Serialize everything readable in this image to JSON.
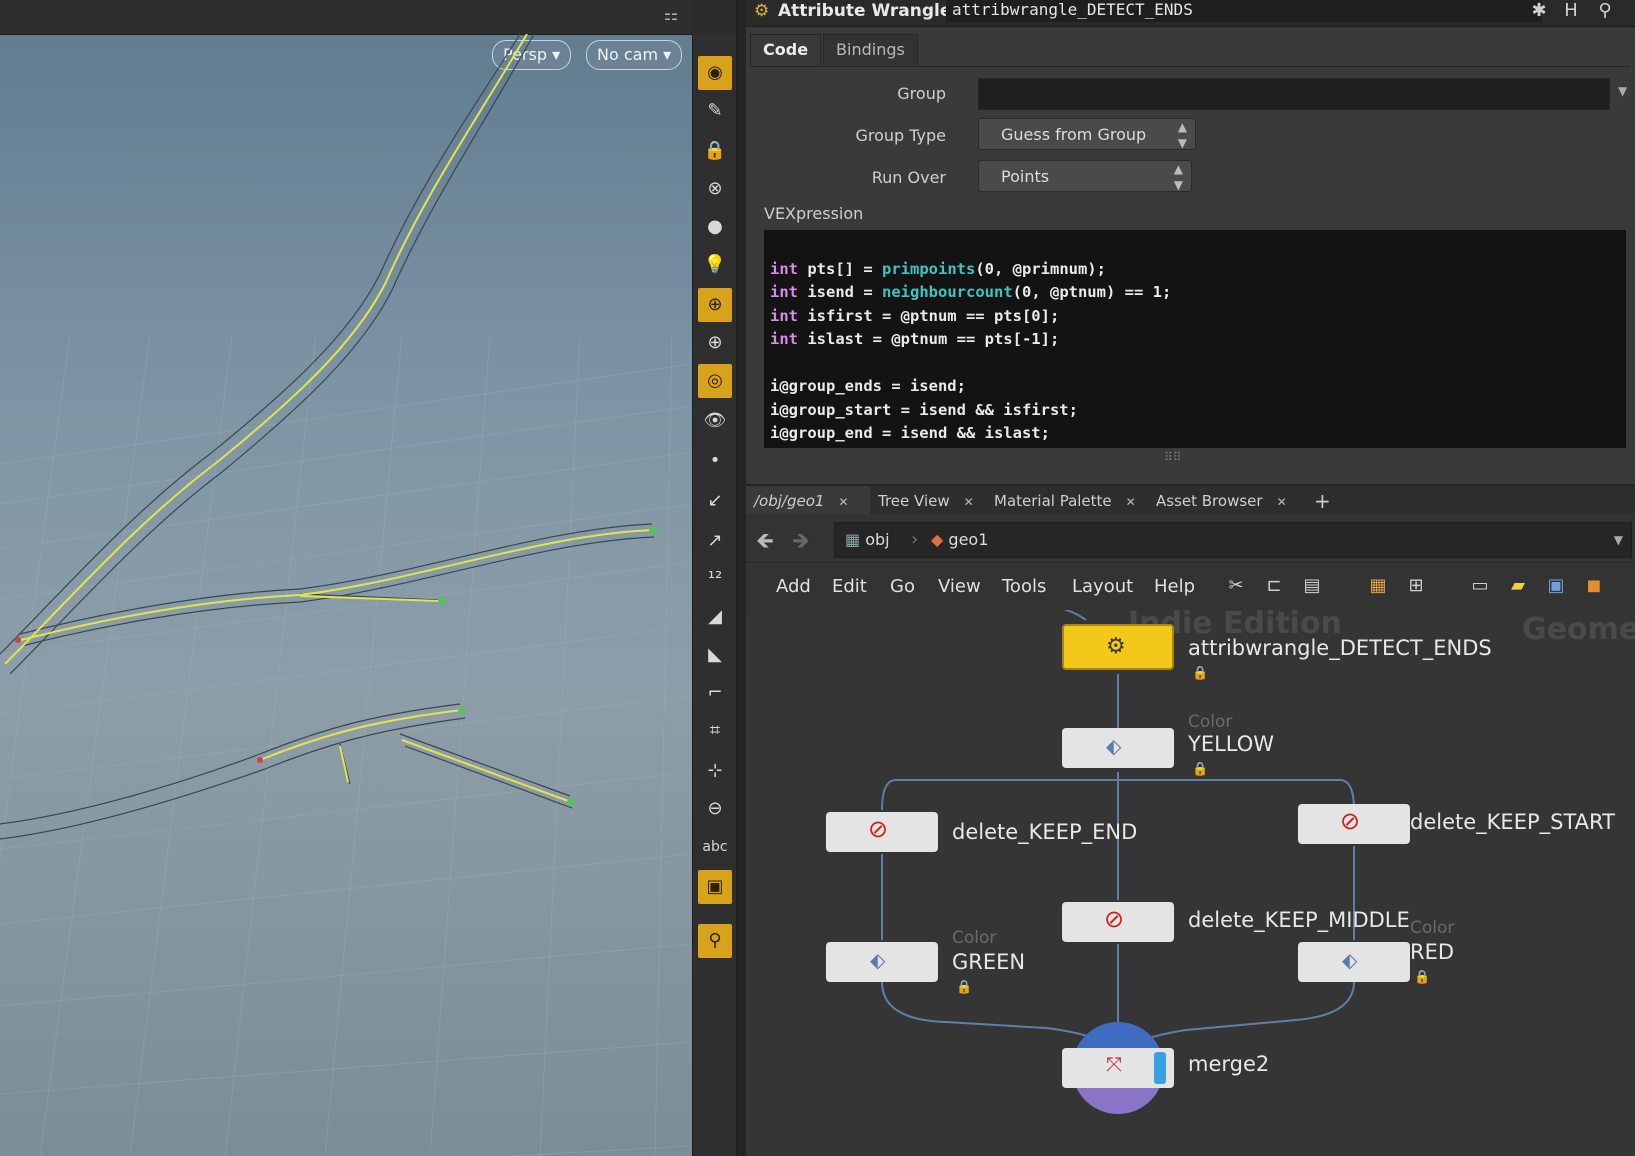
{
  "viewport": {
    "persp_label": "Persp ▾",
    "cam_label": "No cam ▾",
    "tools": [
      {
        "name": "view-tool-icon",
        "glyph": "◉",
        "on": true
      },
      {
        "name": "handle-tool-icon",
        "glyph": "✎",
        "on": false
      },
      {
        "name": "lock-camera-icon",
        "glyph": "🔒",
        "on": false
      },
      {
        "name": "snap-icon",
        "glyph": "⊗",
        "on": false
      },
      {
        "name": "shading-icon",
        "glyph": "●",
        "on": false
      },
      {
        "name": "light-icon",
        "glyph": "💡",
        "on": false
      },
      {
        "name": "pin-icon",
        "glyph": "⊕",
        "on": true
      },
      {
        "name": "pin-add-icon",
        "glyph": "⊕",
        "on": false
      },
      {
        "name": "display-options-icon",
        "glyph": "◎",
        "on": true
      },
      {
        "name": "visibility-icon",
        "glyph": "👁",
        "on": false
      },
      {
        "name": "point-icon",
        "glyph": "•",
        "on": false
      },
      {
        "name": "normal-icon",
        "glyph": "↙",
        "on": false
      },
      {
        "name": "vector-icon",
        "glyph": "↗",
        "on": false
      },
      {
        "name": "point-numbers-icon",
        "glyph": "¹²",
        "on": false
      },
      {
        "name": "prim-normal-icon",
        "glyph": "◢",
        "on": false
      },
      {
        "name": "prim-numbers-icon",
        "glyph": "◣",
        "on": false
      },
      {
        "name": "vertex-icon",
        "glyph": "⌐",
        "on": false
      },
      {
        "name": "bounding-box-icon",
        "glyph": "⌗",
        "on": false
      },
      {
        "name": "origin-icon",
        "glyph": "⊹",
        "on": false
      },
      {
        "name": "ghost-icon",
        "glyph": "⊖",
        "on": false
      },
      {
        "name": "text-label-icon",
        "glyph": "abc",
        "on": false
      },
      {
        "name": "background-image-icon",
        "glyph": "▣",
        "on": true
      },
      {
        "name": "guide-icon",
        "glyph": "⚲",
        "on": true
      }
    ]
  },
  "params": {
    "node_type": "Attribute Wrangle",
    "node_name": "attribwrangle_DETECT_ENDS",
    "tabs": [
      "Code",
      "Bindings"
    ],
    "group_label": "Group",
    "group_value": "",
    "group_type_label": "Group Type",
    "group_type_value": "Guess from Group",
    "run_over_label": "Run Over",
    "run_over_value": "Points",
    "vex_label": "VEXpression",
    "code": {
      "l1_kw": "int",
      "l1_a": " pts[] = ",
      "l1_fn": "primpoints",
      "l1_b": "(0, @primnum);",
      "l2_kw": "int",
      "l2_a": " isend = ",
      "l2_fn": "neighbourcount",
      "l2_b": "(0, @ptnum) == 1;",
      "l3_kw": "int",
      "l3_a": " isfirst = @ptnum == pts[0];",
      "l4_kw": "int",
      "l4_a": " islast = @ptnum == pts[-1];",
      "l6": "i@group_ends = isend;",
      "l7": "i@group_start = isend && isfirst;",
      "l8": "i@group_end = isend && islast;"
    }
  },
  "network": {
    "tabs": [
      "/obj/geo1",
      "Tree View",
      "Material Palette",
      "Asset Browser"
    ],
    "add_tab": "+",
    "path": [
      "obj",
      "geo1"
    ],
    "menu": [
      "Add",
      "Edit",
      "Go",
      "View",
      "Tools",
      "Layout",
      "Help"
    ],
    "watermark": "Indie Edition",
    "context_label": "Geome",
    "nodes": {
      "detect_ends": "attribwrangle_DETECT_ENDS",
      "yellow_sub": "Color",
      "yellow": "YELLOW",
      "keep_end": "delete_KEEP_END",
      "keep_start": "delete_KEEP_START",
      "keep_middle": "delete_KEEP_MIDDLE",
      "green_sub": "Color",
      "green": "GREEN",
      "red_sub": "Color",
      "red": "RED",
      "merge": "merge2"
    }
  },
  "colors": {
    "accent_yellow": "#d9a21b",
    "node_yellow": "#f2c81a",
    "keyword": "#d78be6",
    "function": "#3fc4c0",
    "wire": "#5f7fa6"
  }
}
